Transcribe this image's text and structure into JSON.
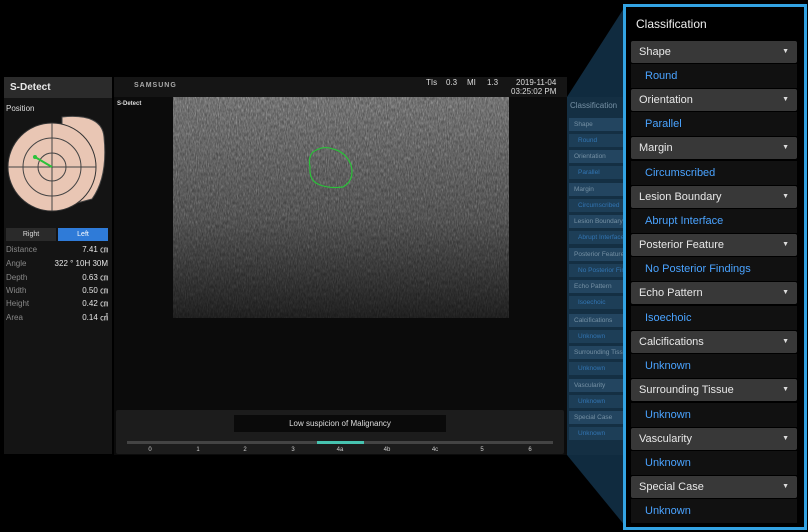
{
  "left_panel": {
    "title": "S-Detect",
    "position_label": "Position",
    "side_buttons": {
      "right": "Right",
      "left": "Left"
    },
    "measurements": [
      {
        "label": "Distance",
        "value": "7.41 ㎝"
      },
      {
        "label": "Angle",
        "value": "322 ° 10H 30M"
      },
      {
        "label": "Depth",
        "value": "0.63 ㎝"
      },
      {
        "label": "Width",
        "value": "0.50 ㎝"
      },
      {
        "label": "Height",
        "value": "0.42 ㎝"
      },
      {
        "label": "Area",
        "value": "0.14 ㎠"
      }
    ]
  },
  "header": {
    "brand": "SAMSUNG",
    "tis_label": "TIs",
    "tis_value": "0.3",
    "mi_label": "MI",
    "mi_value": "1.3",
    "date": "2019-11-04",
    "time": "03:25:02 PM"
  },
  "image_area": {
    "mode_label": "S-Detect"
  },
  "result": {
    "text": "Low suspicion of Malignancy",
    "scale_ticks": [
      "0",
      "1",
      "2",
      "3",
      "4a",
      "4b",
      "4c",
      "5",
      "6"
    ],
    "highlight_tick": "4a"
  },
  "classification": {
    "title": "Classification",
    "items": [
      {
        "category": "Shape",
        "value": "Round"
      },
      {
        "category": "Orientation",
        "value": "Parallel"
      },
      {
        "category": "Margin",
        "value": "Circumscribed"
      },
      {
        "category": "Lesion Boundary",
        "value": "Abrupt Interface"
      },
      {
        "category": "Posterior Feature",
        "value": "No Posterior Findings"
      },
      {
        "category": "Echo Pattern",
        "value": "Isoechoic"
      },
      {
        "category": "Calcifications",
        "value": "Unknown"
      },
      {
        "category": "Surrounding Tissue",
        "value": "Unknown"
      },
      {
        "category": "Vascularity",
        "value": "Unknown"
      },
      {
        "category": "Special Case",
        "value": "Unknown"
      }
    ]
  },
  "colors": {
    "accent_blue": "#33a3e3",
    "value_text_blue": "#4aa3ff",
    "lesion_outline": "#2bc23a",
    "scale_highlight": "#47c3b0",
    "selected_button": "#2f7bd8"
  }
}
